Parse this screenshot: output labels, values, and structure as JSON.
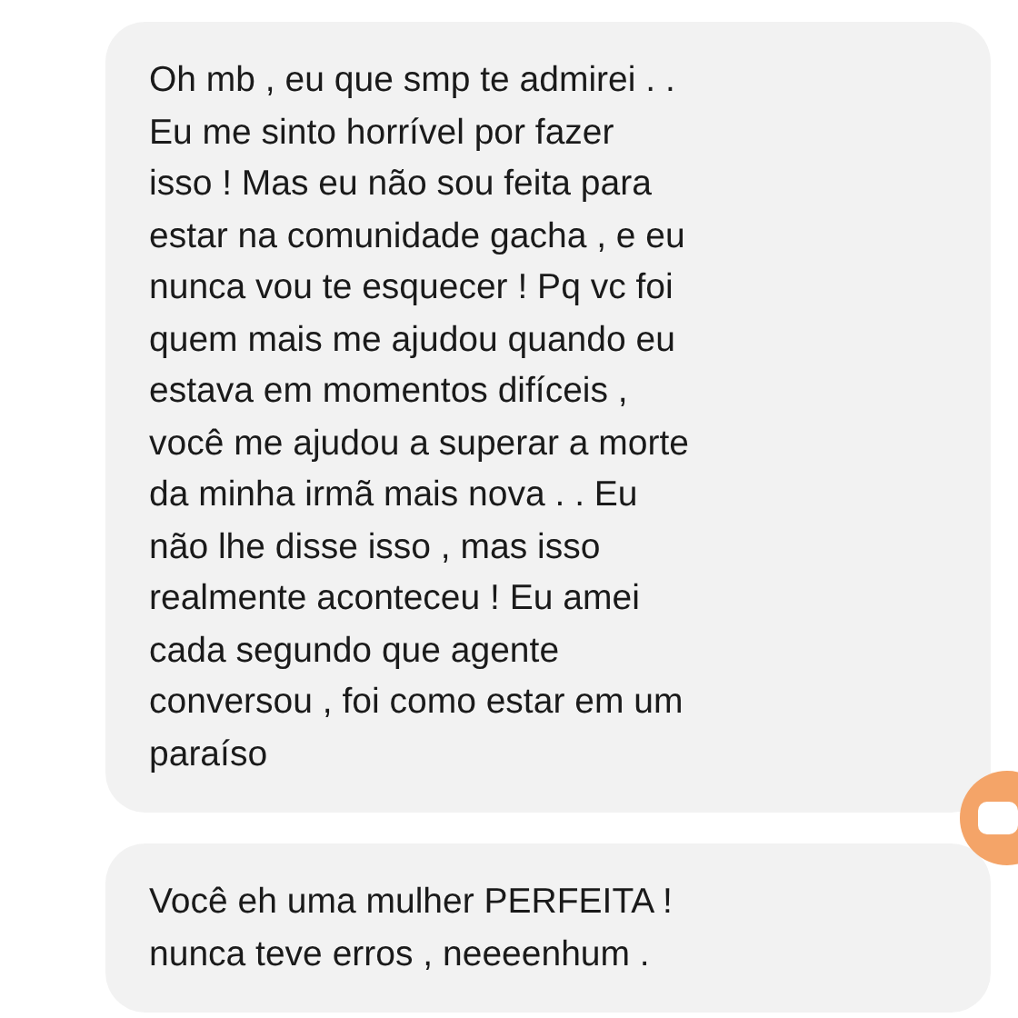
{
  "messages": [
    {
      "text": "Oh mb , eu que smp te admirei . .\nEu me sinto horrível por fazer\nisso ! Mas eu não sou feita para\nestar na comunidade gacha , e eu\nnunca vou te esquecer ! Pq vc foi\nquem mais me ajudou quando eu\nestava em momentos difíceis ,\nvocê me ajudou a superar a morte\nda minha irmã mais nova . . Eu\nnão lhe disse isso , mas isso\nrealmente aconteceu ! Eu amei\ncada segundo que agente\nconversou , foi como estar em um\nparaíso"
    },
    {
      "text": "Você eh uma mulher PERFEITA !\nnunca teve erros , neeeenhum ."
    }
  ]
}
